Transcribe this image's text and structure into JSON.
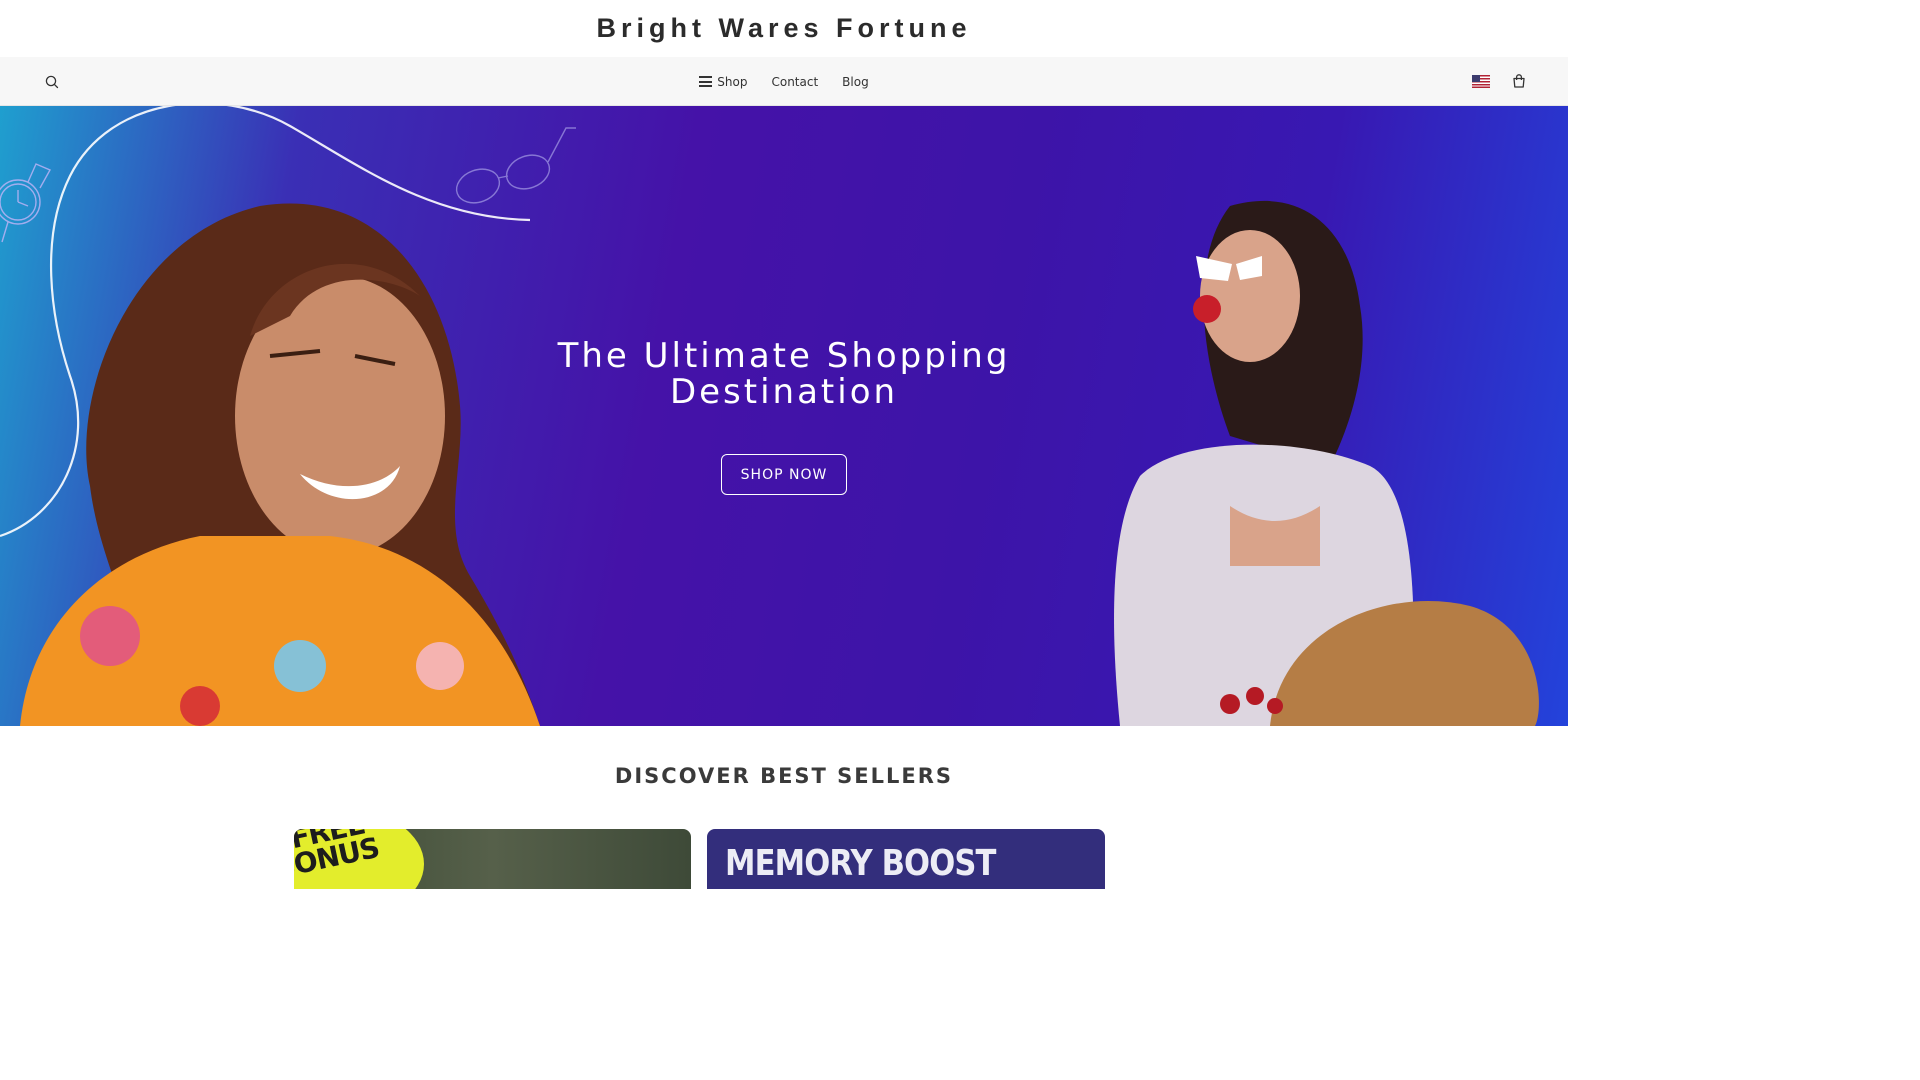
{
  "site": {
    "title": "Bright Wares Fortune"
  },
  "nav": {
    "search_icon": "search-icon",
    "links": [
      {
        "label": "Shop",
        "icon": "menu-icon"
      },
      {
        "label": "Contact"
      },
      {
        "label": "Blog"
      }
    ],
    "flag_icon": "us-flag-icon",
    "cart_icon": "shopping-bag-icon"
  },
  "hero": {
    "heading_line1": "The Ultimate Shopping",
    "heading_line2": "Destination",
    "cta_label": "SHOP NOW",
    "gradient_colors": [
      "#1f9fcf",
      "#4512a8",
      "#2343db"
    ]
  },
  "best_sellers": {
    "title": "DISCOVER BEST SELLERS",
    "cards": [
      {
        "badge_text": "+FREE BONUS"
      },
      {
        "headline": "MEMORY BOOST"
      }
    ]
  }
}
